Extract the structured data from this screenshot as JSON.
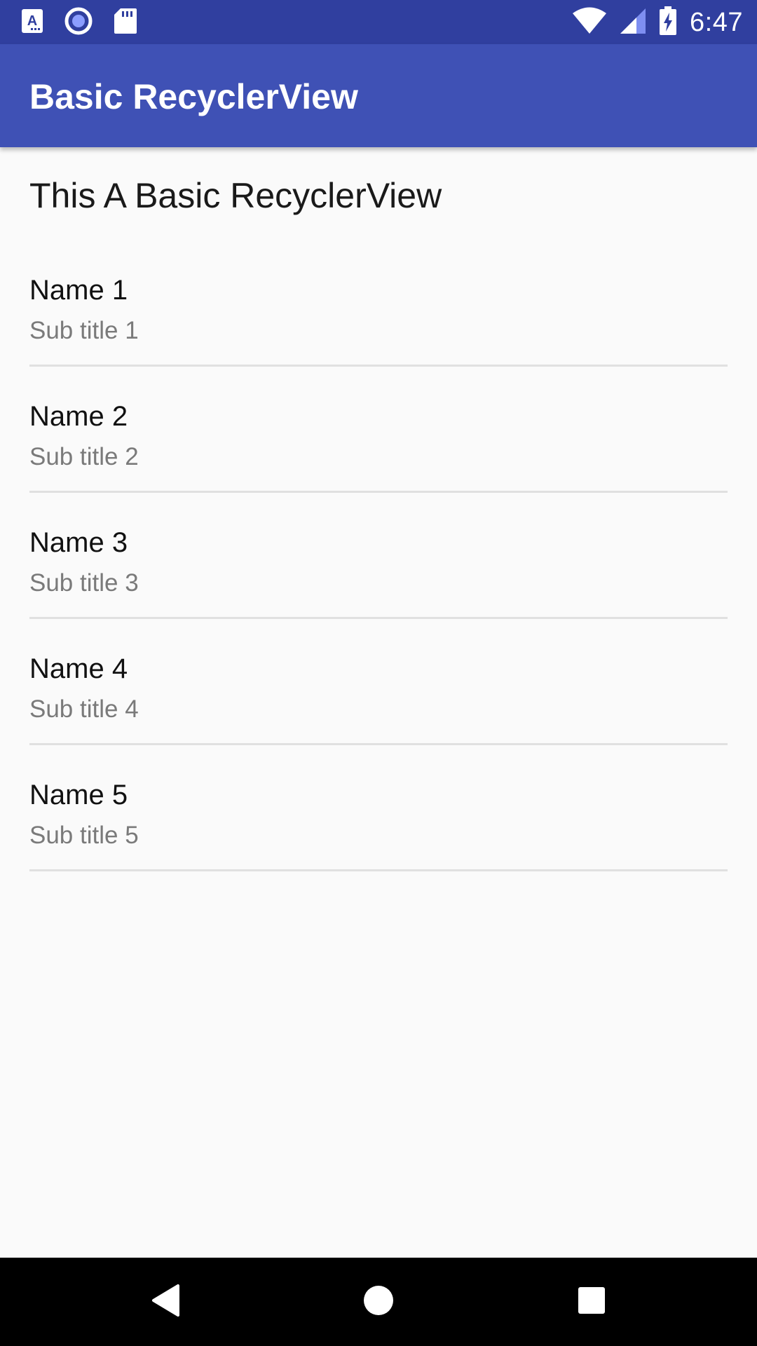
{
  "status_bar": {
    "time": "6:47",
    "left_icons": [
      "accessibility-a-icon",
      "record-icon",
      "sd-card-icon"
    ],
    "right_icons": [
      "wifi-icon",
      "cell-signal-icon",
      "battery-charging-icon"
    ],
    "color": "#303f9f"
  },
  "app_bar": {
    "title": "Basic RecyclerView",
    "color": "#3f51b5"
  },
  "main": {
    "heading": "This A Basic RecyclerView",
    "items": [
      {
        "name": "Name 1",
        "subtitle": "Sub title 1"
      },
      {
        "name": "Name 2",
        "subtitle": "Sub title 2"
      },
      {
        "name": "Name 3",
        "subtitle": "Sub title 3"
      },
      {
        "name": "Name 4",
        "subtitle": "Sub title 4"
      },
      {
        "name": "Name 5",
        "subtitle": "Sub title 5"
      }
    ]
  },
  "nav_bar": {
    "buttons": [
      "back-icon",
      "home-icon",
      "recents-icon"
    ]
  }
}
